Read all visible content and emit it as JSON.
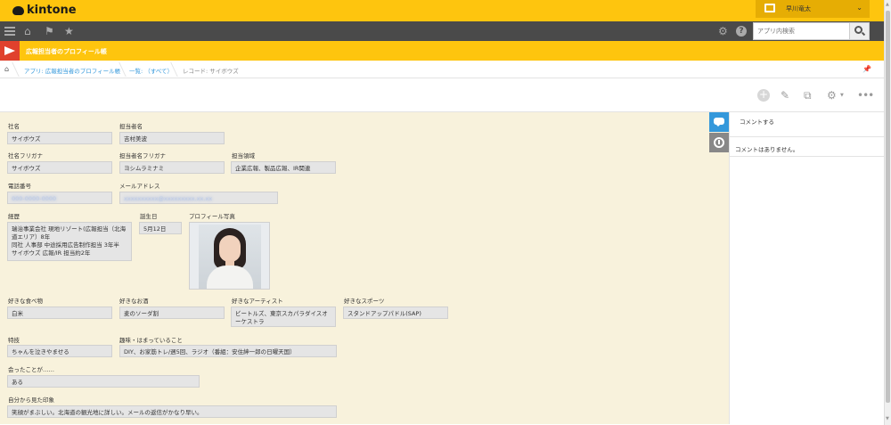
{
  "header": {
    "logo_text": "kintone",
    "user_name": "早川竜太",
    "search_placeholder": "アプリ内検索"
  },
  "app": {
    "title": "広報担当者のプロフィール帳"
  },
  "breadcrumb": [
    "アプリ: 広報担当者のプロフィール帳",
    "一覧: （すべて）",
    "レコード: サイボウズ"
  ],
  "toolbar": {
    "add": "+",
    "more": "•••"
  },
  "fields": {
    "company_name": {
      "label": "社名",
      "value": "サイボウズ"
    },
    "person_name": {
      "label": "担当者名",
      "value": "吉村美波"
    },
    "company_kana": {
      "label": "社名フリガナ",
      "value": "サイボウズ"
    },
    "person_kana": {
      "label": "担当者名フリガナ",
      "value": "ヨシムラミナミ"
    },
    "domain": {
      "label": "担当領域",
      "value": "企業広報、製品広報、IR関連"
    },
    "phone": {
      "label": "電話番号",
      "value": "000-0000-0000"
    },
    "email": {
      "label": "メールアドレス",
      "value": "xxxxxxxxxx@xxxxxxxxx.xx.xx"
    },
    "career": {
      "label": "経歴",
      "value": "瑞治事業会社 現地リゾート(広報担当（北海\n道エリア）8年\n同社 人事部 中途採用広告制作担当 3年半\nサイボウズ 広報/IR 担当約2年"
    },
    "birthday": {
      "label": "誕生日",
      "value": "5月12日"
    },
    "photo": {
      "label": "プロフィール写真"
    },
    "food": {
      "label": "好きな食べ物",
      "value": "白米"
    },
    "drink": {
      "label": "好きなお酒",
      "value": "麦のソーダ割"
    },
    "artist": {
      "label": "好きなアーティスト",
      "value": "ビートルズ、東京スカパラダイスオ\nーケストラ"
    },
    "sport": {
      "label": "好きなスポーツ",
      "value": "スタンドアップパドル(SAP)"
    },
    "skill": {
      "label": "特技",
      "value": "ちゃんを泣きやませる"
    },
    "hobby": {
      "label": "趣味・はまっていること",
      "value": "DIY、お家筋トレ/週5回、ラジオ（番組：安住紳一郎の日曜天国）"
    },
    "met": {
      "label": "会ったことが……",
      "value": "ある"
    },
    "impression": {
      "label": "自分から見た印象",
      "value": "笑顔がまぶしい。北海道の観光地に詳しい。メールの返信がかなり早い。"
    }
  },
  "sidebar": {
    "comment_prompt": "コメントする",
    "no_comments": "コメントはありません。"
  },
  "colors": {
    "header_yellow": "#fec50e",
    "nav_dark": "#4a4a4a",
    "app_icon_red": "#e0412d",
    "content_bg": "#f8f2dc",
    "accent_blue": "#3498db"
  }
}
